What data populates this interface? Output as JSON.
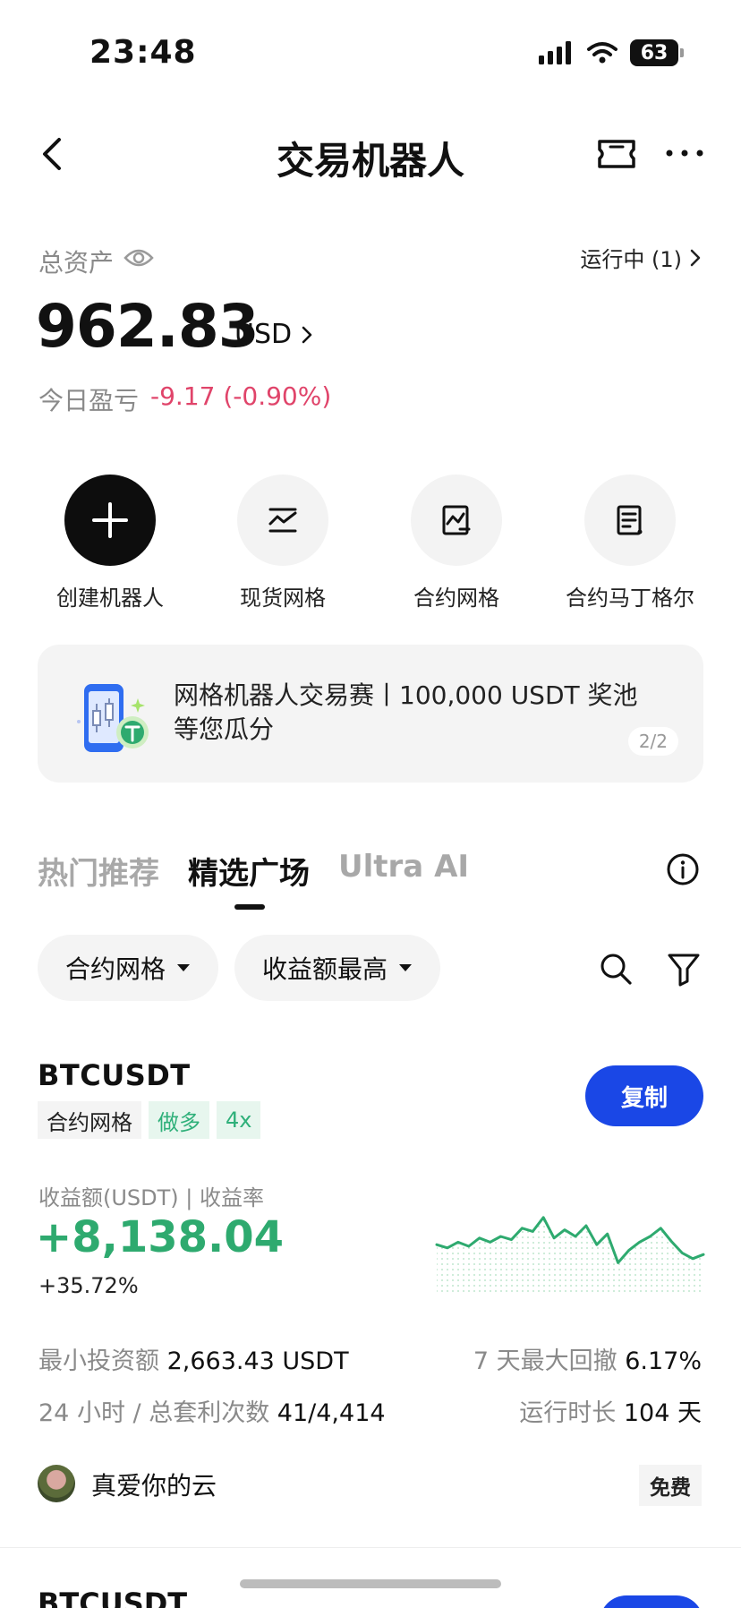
{
  "status_bar": {
    "time": "23:48",
    "battery": "63"
  },
  "header": {
    "title": "交易机器人"
  },
  "assets": {
    "label": "总资产",
    "running": "运行中 (1)",
    "total": "962.83",
    "unit": "USD",
    "pnl_label": "今日盈亏",
    "pnl_value": "-9.17 (-0.90%)"
  },
  "actions": [
    {
      "label": "创建机器人",
      "icon": "plus-icon"
    },
    {
      "label": "现货网格",
      "icon": "grid-chart-icon"
    },
    {
      "label": "合约网格",
      "icon": "contract-chart-icon"
    },
    {
      "label": "合约马丁格尔",
      "icon": "document-icon"
    }
  ],
  "banner": {
    "text": "网格机器人交易赛丨100,000 USDT 奖池等您瓜分",
    "page": "2/2"
  },
  "tabs": [
    {
      "label": "热门推荐",
      "active": false
    },
    {
      "label": "精选广场",
      "active": true
    },
    {
      "label": "Ultra AI",
      "active": false
    }
  ],
  "filters": {
    "type": "合约网格",
    "sort": "收益额最高"
  },
  "card": {
    "pair": "BTCUSDT",
    "tags": [
      "合约网格",
      "做多",
      "4x"
    ],
    "copy_label": "复制",
    "profit_label": "收益额(USDT) | 收益率",
    "profit_value": "+8,138.04",
    "profit_rate": "+35.72%",
    "sparkline": [
      0.52,
      0.48,
      0.55,
      0.5,
      0.6,
      0.55,
      0.62,
      0.58,
      0.72,
      0.68,
      0.85,
      0.6,
      0.7,
      0.62,
      0.75,
      0.52,
      0.65,
      0.3,
      0.45,
      0.55,
      0.62,
      0.72,
      0.56,
      0.42,
      0.35,
      0.4
    ],
    "metrics": {
      "min_invest_label": "最小投资额",
      "min_invest_value": "2,663.43 USDT",
      "drawdown_label": "7 天最大回撤",
      "drawdown_value": "6.17%",
      "arb_label": "24 小时 / 总套利次数",
      "arb_value": "41/4,414",
      "runtime_label": "运行时长",
      "runtime_value": "104 天"
    },
    "author": "真爱你的云",
    "fee": "免费"
  },
  "next_card": {
    "pair": "BTCUSDT"
  },
  "colors": {
    "accent": "#1a47e6",
    "profit": "#2eaa6f",
    "loss": "#e0446a"
  }
}
